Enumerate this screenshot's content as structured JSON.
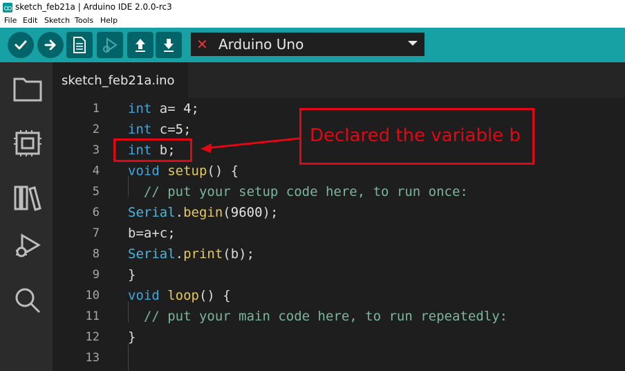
{
  "window": {
    "title": "sketch_feb21a | Arduino IDE 2.0.0-rc3"
  },
  "menu": [
    "File",
    "Edit",
    "Sketch",
    "Tools",
    "Help"
  ],
  "toolbar": {
    "board": {
      "name": "Arduino Uno",
      "status_icon": "x-icon"
    }
  },
  "sidebar": {
    "icons": [
      "folder-icon",
      "board-manager-icon",
      "library-icon",
      "debug-icon",
      "search-icon"
    ]
  },
  "editor": {
    "tab": "sketch_feb21a.ino",
    "lines": [
      {
        "n": "1",
        "code": "int a= 4;"
      },
      {
        "n": "2",
        "code": "int c=5;"
      },
      {
        "n": "3",
        "code": "int b;"
      },
      {
        "n": "4",
        "code": "void setup() {"
      },
      {
        "n": "5",
        "code": "  // put your setup code here, to run once:"
      },
      {
        "n": "6",
        "code": "Serial.begin(9600);"
      },
      {
        "n": "7",
        "code": "b=a+c;"
      },
      {
        "n": "8",
        "code": "Serial.print(b);"
      },
      {
        "n": "9",
        "code": "}"
      },
      {
        "n": "10",
        "code": "void loop() {"
      },
      {
        "n": "11",
        "code": "  // put your main code here, to run repeatedly:"
      },
      {
        "n": "12",
        "code": "}"
      },
      {
        "n": "13",
        "code": ""
      }
    ]
  },
  "annotation": {
    "text": "Declared the variable b",
    "color": "#e30613"
  }
}
